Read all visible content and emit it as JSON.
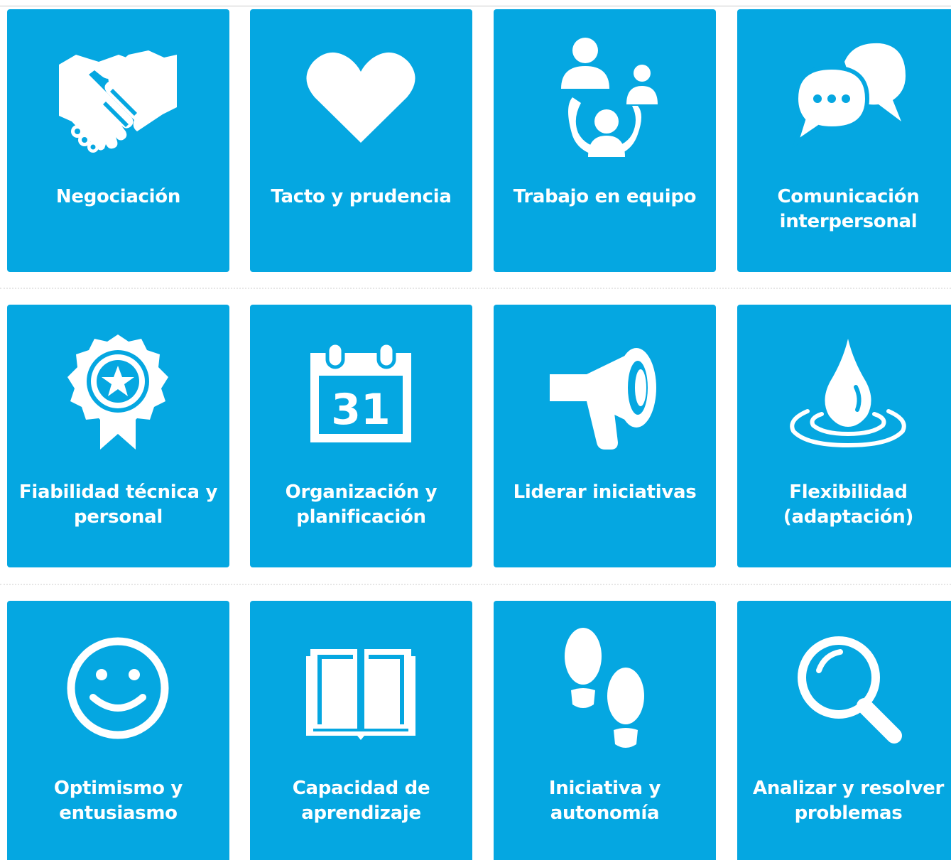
{
  "colors": {
    "tile_background": "#05a7e1",
    "tile_foreground": "#ffffff",
    "page_background": "#ffffff"
  },
  "tiles": [
    {
      "label": "Negociación",
      "icon": "handshake-icon"
    },
    {
      "label": "Tacto y prudencia",
      "icon": "heart-icon"
    },
    {
      "label": "Trabajo en equipo",
      "icon": "team-icon"
    },
    {
      "label": "Comunicación interpersonal",
      "icon": "chat-bubbles-icon"
    },
    {
      "label": "Fiabilidad técnica y personal",
      "icon": "award-badge-icon"
    },
    {
      "label": "Organización y planificación",
      "icon": "calendar-icon",
      "calendar_day": "31"
    },
    {
      "label": "Liderar iniciativas",
      "icon": "megaphone-icon"
    },
    {
      "label": "Flexibilidad (adaptación)",
      "icon": "water-drop-icon"
    },
    {
      "label": "Optimismo y entusiasmo",
      "icon": "smiley-icon"
    },
    {
      "label": "Capacidad de aprendizaje",
      "icon": "open-book-icon"
    },
    {
      "label": "Iniciativa y autonomía",
      "icon": "footprints-icon"
    },
    {
      "label": "Analizar y resolver problemas",
      "icon": "magnifier-icon"
    }
  ]
}
